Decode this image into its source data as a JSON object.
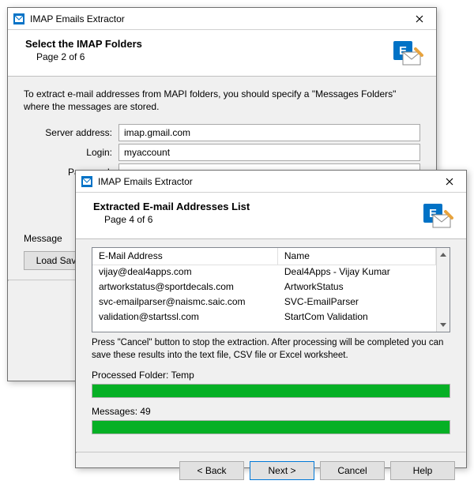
{
  "win1": {
    "title": "IMAP Emails Extractor",
    "heading": "Select the IMAP Folders",
    "page": "Page 2 of 6",
    "instruction": "To extract e-mail addresses from MAPI folders, you should specify a \"Messages Folders\" where the messages are stored.",
    "labels": {
      "server": "Server address:",
      "login": "Login:",
      "password": "Password:",
      "folder": "Message"
    },
    "values": {
      "server": "imap.gmail.com",
      "login": "myaccount",
      "password": "●●●●●●●●●"
    },
    "loadsav": "Load Sav"
  },
  "win2": {
    "title": "IMAP Emails Extractor",
    "heading": "Extracted E-mail Addresses List",
    "page": "Page 4 of 6",
    "cols": {
      "a": "E-Mail Address",
      "b": "Name"
    },
    "rows": [
      {
        "a": "vijay@deal4apps.com",
        "b": "Deal4Apps - Vijay Kumar"
      },
      {
        "a": "artworkstatus@sportdecals.com",
        "b": "ArtworkStatus"
      },
      {
        "a": "svc-emailparser@naismc.saic.com",
        "b": "SVC-EmailParser"
      },
      {
        "a": "validation@startssl.com",
        "b": "StartCom Validation"
      }
    ],
    "note": "Press \"Cancel\" button to stop the extraction. After processing will be completed you can save these results into the text file, CSV file or Excel worksheet.",
    "processed": "Processed Folder: Temp",
    "messages": "Messages: 49",
    "btns": {
      "back": "< Back",
      "next": "Next >",
      "cancel": "Cancel",
      "help": "Help"
    }
  }
}
